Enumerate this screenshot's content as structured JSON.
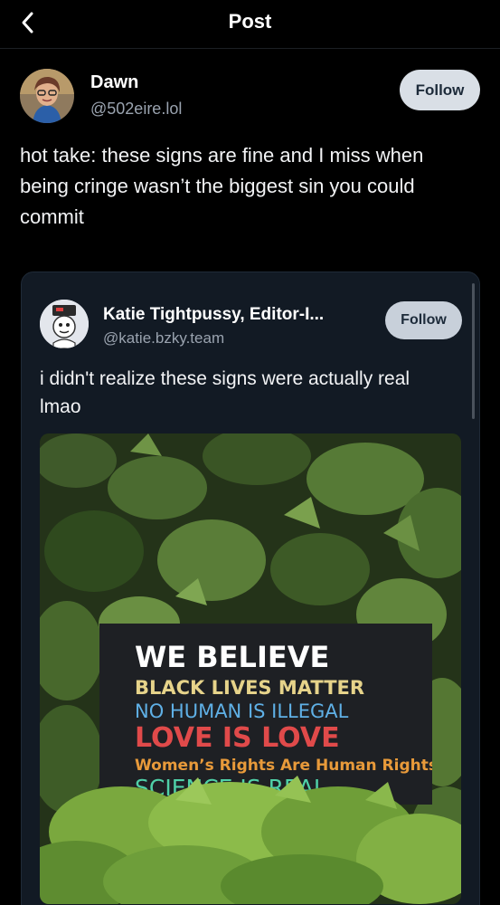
{
  "header": {
    "title": "Post"
  },
  "post": {
    "author_name": "Dawn",
    "author_handle": "@502eire.lol",
    "follow_label": "Follow",
    "text": "hot take: these signs are fine and I miss when being cringe wasn’t the biggest sin you could commit"
  },
  "quote": {
    "author_name": "Katie Tightpussy, Editor-I...",
    "author_handle": "@katie.bzky.team",
    "follow_label": "Follow",
    "text": "i didn't realize these signs were actually real lmao",
    "sign": {
      "line1": "WE BELIEVE",
      "line2": "BLACK LIVES MATTER",
      "line3": "NO HUMAN IS ILLEGAL",
      "line4": "LOVE IS LOVE",
      "line5": "Women’s Rights Are Human Rights",
      "line6": "SCIENCE IS REAL"
    }
  },
  "colors": {
    "background": "#000000",
    "quote_background": "#121a24",
    "follow_button": "#d9dfe6",
    "handle_gray": "#9aa3af",
    "sign_black_lives": "#e6d38a",
    "sign_no_human": "#5fb0e6",
    "sign_love": "#e04a4a",
    "sign_womens_rights": "#e89a3a",
    "sign_science": "#4fd0a8"
  },
  "icons": {
    "back": "chevron-left-icon"
  }
}
